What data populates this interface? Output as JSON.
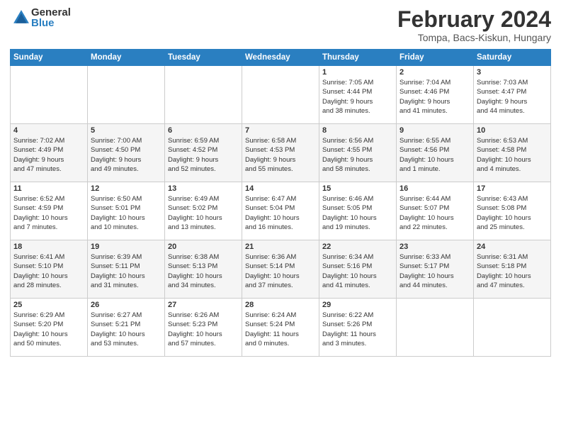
{
  "header": {
    "logo_general": "General",
    "logo_blue": "Blue",
    "month_title": "February 2024",
    "location": "Tompa, Bacs-Kiskun, Hungary"
  },
  "days_of_week": [
    "Sunday",
    "Monday",
    "Tuesday",
    "Wednesday",
    "Thursday",
    "Friday",
    "Saturday"
  ],
  "weeks": [
    [
      {
        "num": "",
        "info": ""
      },
      {
        "num": "",
        "info": ""
      },
      {
        "num": "",
        "info": ""
      },
      {
        "num": "",
        "info": ""
      },
      {
        "num": "1",
        "info": "Sunrise: 7:05 AM\nSunset: 4:44 PM\nDaylight: 9 hours\nand 38 minutes."
      },
      {
        "num": "2",
        "info": "Sunrise: 7:04 AM\nSunset: 4:46 PM\nDaylight: 9 hours\nand 41 minutes."
      },
      {
        "num": "3",
        "info": "Sunrise: 7:03 AM\nSunset: 4:47 PM\nDaylight: 9 hours\nand 44 minutes."
      }
    ],
    [
      {
        "num": "4",
        "info": "Sunrise: 7:02 AM\nSunset: 4:49 PM\nDaylight: 9 hours\nand 47 minutes."
      },
      {
        "num": "5",
        "info": "Sunrise: 7:00 AM\nSunset: 4:50 PM\nDaylight: 9 hours\nand 49 minutes."
      },
      {
        "num": "6",
        "info": "Sunrise: 6:59 AM\nSunset: 4:52 PM\nDaylight: 9 hours\nand 52 minutes."
      },
      {
        "num": "7",
        "info": "Sunrise: 6:58 AM\nSunset: 4:53 PM\nDaylight: 9 hours\nand 55 minutes."
      },
      {
        "num": "8",
        "info": "Sunrise: 6:56 AM\nSunset: 4:55 PM\nDaylight: 9 hours\nand 58 minutes."
      },
      {
        "num": "9",
        "info": "Sunrise: 6:55 AM\nSunset: 4:56 PM\nDaylight: 10 hours\nand 1 minute."
      },
      {
        "num": "10",
        "info": "Sunrise: 6:53 AM\nSunset: 4:58 PM\nDaylight: 10 hours\nand 4 minutes."
      }
    ],
    [
      {
        "num": "11",
        "info": "Sunrise: 6:52 AM\nSunset: 4:59 PM\nDaylight: 10 hours\nand 7 minutes."
      },
      {
        "num": "12",
        "info": "Sunrise: 6:50 AM\nSunset: 5:01 PM\nDaylight: 10 hours\nand 10 minutes."
      },
      {
        "num": "13",
        "info": "Sunrise: 6:49 AM\nSunset: 5:02 PM\nDaylight: 10 hours\nand 13 minutes."
      },
      {
        "num": "14",
        "info": "Sunrise: 6:47 AM\nSunset: 5:04 PM\nDaylight: 10 hours\nand 16 minutes."
      },
      {
        "num": "15",
        "info": "Sunrise: 6:46 AM\nSunset: 5:05 PM\nDaylight: 10 hours\nand 19 minutes."
      },
      {
        "num": "16",
        "info": "Sunrise: 6:44 AM\nSunset: 5:07 PM\nDaylight: 10 hours\nand 22 minutes."
      },
      {
        "num": "17",
        "info": "Sunrise: 6:43 AM\nSunset: 5:08 PM\nDaylight: 10 hours\nand 25 minutes."
      }
    ],
    [
      {
        "num": "18",
        "info": "Sunrise: 6:41 AM\nSunset: 5:10 PM\nDaylight: 10 hours\nand 28 minutes."
      },
      {
        "num": "19",
        "info": "Sunrise: 6:39 AM\nSunset: 5:11 PM\nDaylight: 10 hours\nand 31 minutes."
      },
      {
        "num": "20",
        "info": "Sunrise: 6:38 AM\nSunset: 5:13 PM\nDaylight: 10 hours\nand 34 minutes."
      },
      {
        "num": "21",
        "info": "Sunrise: 6:36 AM\nSunset: 5:14 PM\nDaylight: 10 hours\nand 37 minutes."
      },
      {
        "num": "22",
        "info": "Sunrise: 6:34 AM\nSunset: 5:16 PM\nDaylight: 10 hours\nand 41 minutes."
      },
      {
        "num": "23",
        "info": "Sunrise: 6:33 AM\nSunset: 5:17 PM\nDaylight: 10 hours\nand 44 minutes."
      },
      {
        "num": "24",
        "info": "Sunrise: 6:31 AM\nSunset: 5:18 PM\nDaylight: 10 hours\nand 47 minutes."
      }
    ],
    [
      {
        "num": "25",
        "info": "Sunrise: 6:29 AM\nSunset: 5:20 PM\nDaylight: 10 hours\nand 50 minutes."
      },
      {
        "num": "26",
        "info": "Sunrise: 6:27 AM\nSunset: 5:21 PM\nDaylight: 10 hours\nand 53 minutes."
      },
      {
        "num": "27",
        "info": "Sunrise: 6:26 AM\nSunset: 5:23 PM\nDaylight: 10 hours\nand 57 minutes."
      },
      {
        "num": "28",
        "info": "Sunrise: 6:24 AM\nSunset: 5:24 PM\nDaylight: 11 hours\nand 0 minutes."
      },
      {
        "num": "29",
        "info": "Sunrise: 6:22 AM\nSunset: 5:26 PM\nDaylight: 11 hours\nand 3 minutes."
      },
      {
        "num": "",
        "info": ""
      },
      {
        "num": "",
        "info": ""
      }
    ]
  ]
}
